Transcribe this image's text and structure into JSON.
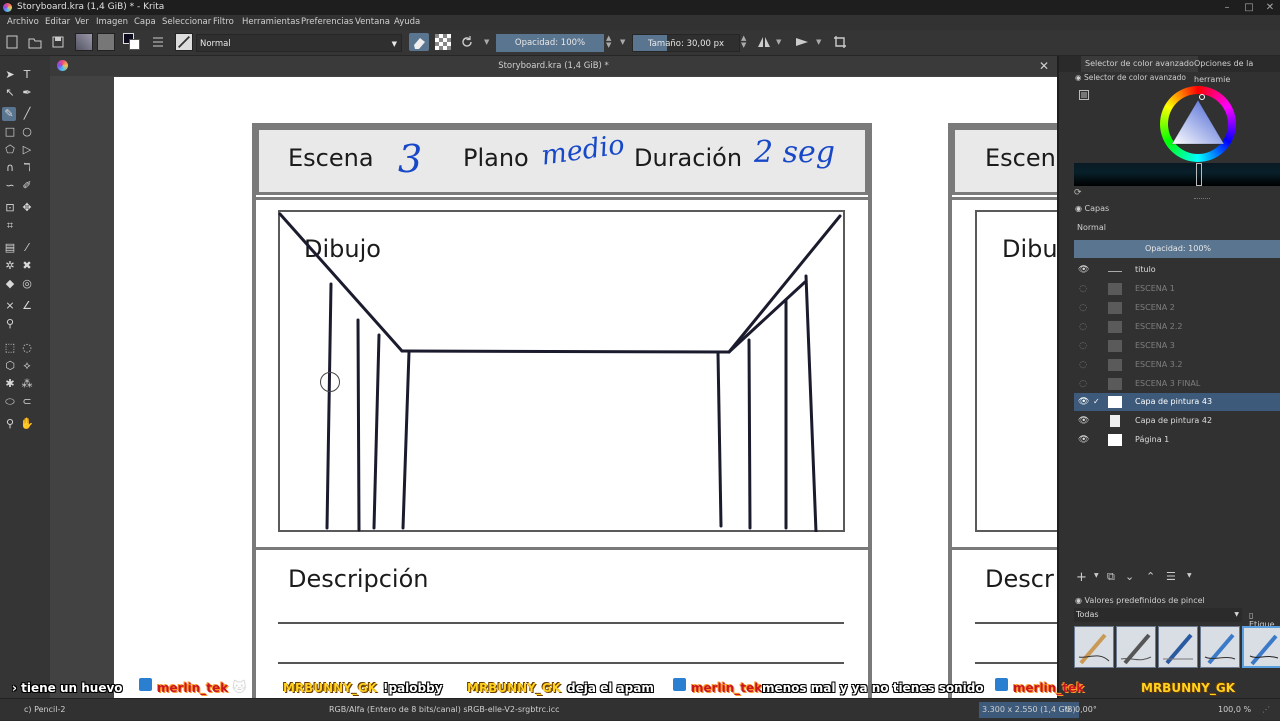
{
  "window": {
    "title": "Storyboard.kra (1,4 GiB) * - Krita",
    "doc_tab": "Storyboard.kra (1,4 GiB) *"
  },
  "menu": [
    "Archivo",
    "Editar",
    "Ver",
    "Imagen",
    "Capa",
    "Seleccionar",
    "Filtro",
    "Herramientas",
    "Preferencias",
    "Ventana",
    "Ayuda"
  ],
  "toolbar": {
    "blend_mode": "Normal",
    "opacity": "Opacidad: 100%",
    "size": "Tamaño: 30,00 px"
  },
  "storyboard": {
    "scene_label": "Escena",
    "scene_value": "3",
    "shot_label": "Plano",
    "shot_value": "medio",
    "duration_label": "Duración",
    "duration_value": "2 seg",
    "drawing_label": "Dibujo",
    "description_label": "Descripción",
    "second_scene_label": "Escen",
    "second_drawing_label": "Dibu",
    "second_description_label": "Descr"
  },
  "docker": {
    "tab1": "Selector de color avanzado",
    "tab2": "Opciones de la herramie",
    "color_title": "Selector de color avanzado",
    "layers_title": "Capas",
    "layers_blend": "Normal",
    "layers_opacity": "Opacidad:  100%",
    "layers": [
      {
        "name": "titulo",
        "visible": true,
        "active": false
      },
      {
        "name": "ESCENA 1",
        "visible": false,
        "active": false
      },
      {
        "name": "ESCENA 2",
        "visible": false,
        "active": false
      },
      {
        "name": "ESCENA 2.2",
        "visible": false,
        "active": false
      },
      {
        "name": "ESCENA 3",
        "visible": false,
        "active": false
      },
      {
        "name": "ESCENA 3.2",
        "visible": false,
        "active": false
      },
      {
        "name": "ESCENA 3 FINAL",
        "visible": false,
        "active": false
      },
      {
        "name": "Capa de pintura 43",
        "visible": true,
        "active": true
      },
      {
        "name": "Capa de pintura 42",
        "visible": true,
        "active": false
      },
      {
        "name": "Página 1",
        "visible": true,
        "active": false
      }
    ],
    "presets_title": "Valores predefinidos de pincel",
    "presets_filter": "Todas",
    "presets_tag": "Etique"
  },
  "chat": [
    {
      "user": "",
      "text": "› tiene un huevo"
    },
    {
      "user": "merlin_tek",
      "text": ""
    },
    {
      "user": "MRBUNNY_GK",
      "text": "!palobby"
    },
    {
      "user": "MRBUNNY_GK",
      "text": "deja el apam"
    },
    {
      "user": "merlin_tek",
      "text": "menos mal y ya no tienes sonido"
    },
    {
      "user": "merlin_tek",
      "text": ""
    },
    {
      "user": "MRBUNNY_GK",
      "text": ""
    }
  ],
  "status": {
    "brush": "c) Pencil-2",
    "color_space": "RGB/Alfa (Entero de 8 bits/canal)  sRGB-elle-V2-srgbtrc.icc",
    "dims": "3.300 x 2.550 (1,4 GiB)",
    "rotation": "0,00°",
    "zoom": "100,0 %"
  },
  "colors": {
    "accent": "#4a6a8a",
    "active_layer": "#3d5a7a",
    "ink": "#1b1b2e"
  }
}
